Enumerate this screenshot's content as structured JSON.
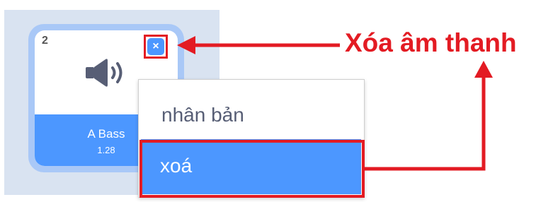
{
  "sound_tile": {
    "index": "2",
    "name": "A Bass",
    "duration": "1.28",
    "delete_glyph": "×",
    "icon": "speaker-icon"
  },
  "context_menu": {
    "items": [
      "nhân bản",
      "xoá"
    ],
    "selected_index": 1
  },
  "annotation": {
    "callout_text": "Xóa âm thanh",
    "color": "#e31b23"
  },
  "colors": {
    "accent": "#4c97ff",
    "tile_halo": "#a9c8f7",
    "panel_bg": "#d9e3f1",
    "annotation_red": "#e31b23"
  }
}
